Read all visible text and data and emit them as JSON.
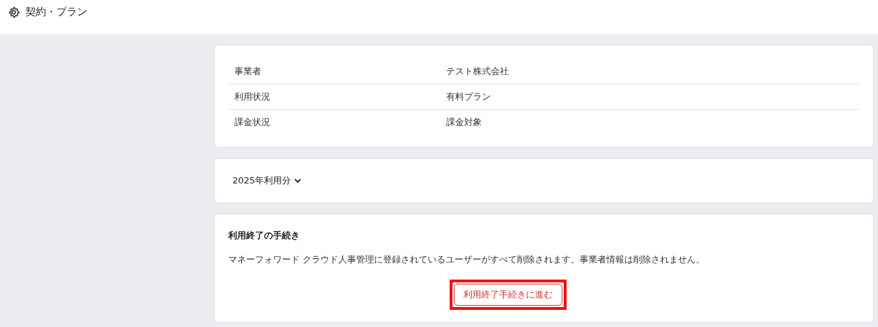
{
  "header": {
    "title": "契約・プラン"
  },
  "info_table": {
    "rows": [
      {
        "label": "事業者",
        "value": "テスト株式会社"
      },
      {
        "label": "利用状況",
        "value": "有料プラン"
      },
      {
        "label": "課金状況",
        "value": "課金対象"
      }
    ]
  },
  "usage": {
    "label": "2025年利用分",
    "expanded": false
  },
  "termination": {
    "title": "利用終了の手続き",
    "description": "マネーフォワード クラウド人事管理に登録されているユーザーがすべて削除されます。事業者情報は削除されません。",
    "button": "利用終了手続きに進む"
  }
}
